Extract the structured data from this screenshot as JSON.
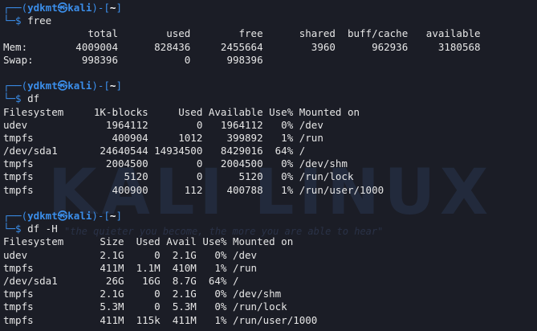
{
  "prompt": {
    "user_host": "ydkmt㉿kali",
    "dir": "~"
  },
  "blocks": [
    {
      "command": "free",
      "output": [
        "              total        used        free      shared  buff/cache   available",
        "Mem:        4009004      828436     2455664        3960      962936     3180568",
        "Swap:        998396           0      998396"
      ]
    },
    {
      "command": "df",
      "output": [
        "Filesystem     1K-blocks     Used Available Use% Mounted on",
        "udev             1964112        0   1964112   0% /dev",
        "tmpfs             400904     1012    399892   1% /run",
        "/dev/sda1       24640544 14934500   8429016  64% /",
        "tmpfs            2004500        0   2004500   0% /dev/shm",
        "tmpfs               5120        0      5120   0% /run/lock",
        "tmpfs             400900      112    400788   1% /run/user/1000"
      ]
    },
    {
      "command": "df -H",
      "output": [
        "Filesystem      Size  Used Avail Use% Mounted on",
        "udev            2.1G     0  2.1G   0% /dev",
        "tmpfs           411M  1.1M  410M   1% /run",
        "/dev/sda1        26G   16G  8.7G  64% /",
        "tmpfs           2.1G     0  2.1G   0% /dev/shm",
        "tmpfs           5.3M     0  5.3M   0% /run/lock",
        "tmpfs           411M  115k  411M   1% /run/user/1000"
      ]
    }
  ],
  "watermark": {
    "logo_text": "KALI LINUX",
    "quote": "\"the quieter you become, the more you are able to hear\""
  },
  "colors": {
    "background": "#1b1d26",
    "prompt_accent": "#3b8eea",
    "text": "#e6e6e6"
  }
}
